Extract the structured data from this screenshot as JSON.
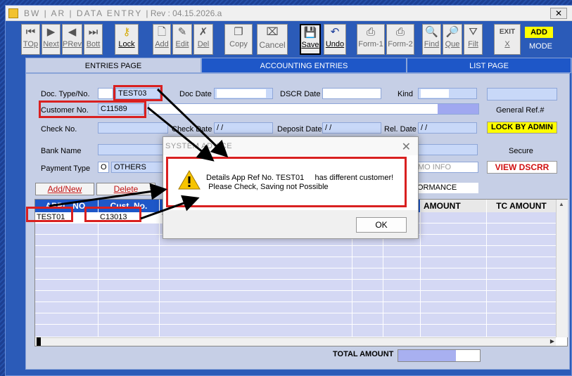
{
  "window": {
    "title": "BW | AR | DATA ENTRY",
    "rev": "| Rev : 04.15.2026.a",
    "close_glyph": "✕"
  },
  "toolbar": {
    "top": "TOp",
    "next": "Next",
    "prev": "PRev",
    "bott": "Bott",
    "lock": "Lock",
    "add": "Add",
    "edit": "Edit",
    "del": "Del",
    "copy": "Copy",
    "cancel": "Cancel",
    "save": "Save",
    "undo": "Undo",
    "form1": "Form-1",
    "form2": "Form-2",
    "find": "Find",
    "que": "Que",
    "filt": "Filt",
    "exit_top": "EXIT",
    "exit": "X",
    "mode_value": "ADD",
    "mode_label": "MODE"
  },
  "tabs": [
    "ENTRIES PAGE",
    "ACCOUNTING ENTRIES",
    "LIST PAGE"
  ],
  "form": {
    "doc_type_label": "Doc. Type/No.",
    "doc_no": "TEST03",
    "doc_date_label": "Doc Date",
    "dscr_date_label": "DSCR Date",
    "kind_label": "Kind",
    "customer_label": "Customer No.",
    "customer_no": "C11589",
    "general_ref_label": "General Ref.#",
    "check_no_label": "Check No.",
    "check_date_label": "Check Date",
    "check_date": "/ /",
    "deposit_date_label": "Deposit Date",
    "deposit_date": "/ /",
    "rel_date_label": "Rel. Date",
    "rel_date": "/ /",
    "lock_by_admin": "LOCK BY ADMIN",
    "bank_name_label": "Bank Name",
    "secure_label": "Secure",
    "payment_type_label": "Payment Type",
    "payment_code": "O",
    "payment_type": "OTHERS",
    "memo_info": "MO INFO",
    "view_dscrr": "VIEW DSCRR"
  },
  "grid": {
    "add_new": "Add/New",
    "delete": "Delete",
    "performance": "ORMANCE",
    "columns": [
      "APPL. NO.",
      "Cust. No.",
      "AMOUNT",
      "TC AMOUNT"
    ],
    "rows": [
      {
        "appl_no": "TEST01",
        "cust_no": "C13013",
        "extra": "TI"
      }
    ],
    "total_label": "TOTAL AMOUNT"
  },
  "dialog": {
    "title": "SYSTEM ADVICE",
    "close": "✕",
    "line1": "Details App Ref No. TEST01     has different customer!",
    "line2": "Please Check, Saving not Possible",
    "ok": "OK"
  },
  "colors": {
    "accent": "#1e57c8",
    "highlight": "#d92020",
    "yellow": "#ffff00"
  }
}
